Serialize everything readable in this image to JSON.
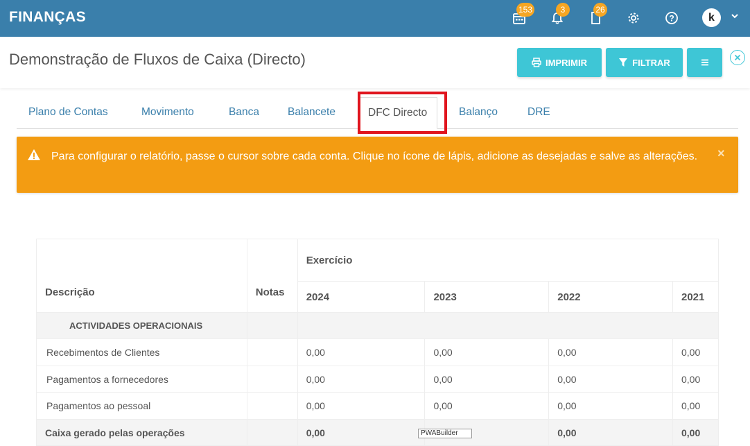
{
  "app": {
    "brand": "FINANÇAS"
  },
  "topbar": {
    "calendar_badge": "153",
    "notifications_badge": "3",
    "documents_badge": "26",
    "avatar_letter": "k"
  },
  "header": {
    "title": "Demonstração de Fluxos de Caixa (Directo)",
    "print_label": "IMPRIMIR",
    "filter_label": "FILTRAR"
  },
  "tabs": [
    {
      "label": "Plano de Contas"
    },
    {
      "label": "Movimento"
    },
    {
      "label": "Banca"
    },
    {
      "label": "Balancete"
    },
    {
      "label": "DFC Directo",
      "active": true
    },
    {
      "label": "Balanço"
    },
    {
      "label": "DRE"
    }
  ],
  "alert": {
    "message": "Para configurar o relatório, passe o cursor sobre cada conta. Clique no ícone de lápis, adicione as desejadas e salve as alterações.",
    "close": "×"
  },
  "table": {
    "col_description": "Descrição",
    "col_notes": "Notas",
    "col_exercise": "Exercício",
    "years": [
      "2024",
      "2023",
      "2022",
      "2021"
    ],
    "section": "ACTIVIDADES OPERACIONAIS",
    "rows": [
      {
        "label": "Recebimentos de Clientes",
        "values": [
          "0,00",
          "0,00",
          "0,00",
          "0,00"
        ]
      },
      {
        "label": "Pagamentos a fornecedores",
        "values": [
          "0,00",
          "0,00",
          "0,00",
          "0,00"
        ]
      },
      {
        "label": "Pagamentos ao pessoal",
        "values": [
          "0,00",
          "0,00",
          "0,00",
          "0,00"
        ]
      }
    ],
    "total": {
      "label": "Caixa gerado pelas operações",
      "values": [
        "0,00",
        "",
        "0,00",
        "0,00"
      ]
    }
  },
  "overlay": {
    "builder_label": "PWABuilder"
  },
  "colors": {
    "topbar": "#3a7fab",
    "button": "#3ec6d6",
    "alert": "#f39c12",
    "badge": "#f5a623",
    "highlight": "#e0151e"
  }
}
